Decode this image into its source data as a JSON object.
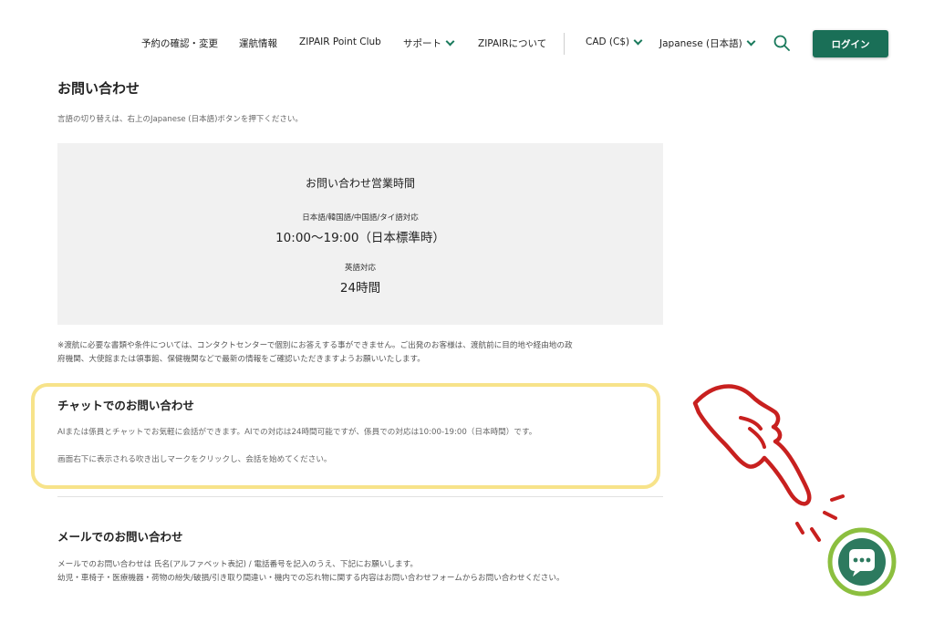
{
  "header": {
    "nav": [
      {
        "label": "予約の確認・変更"
      },
      {
        "label": "運航情報"
      },
      {
        "label": "ZIPAIR Point Club"
      },
      {
        "label": "サポート"
      },
      {
        "label": "ZIPAIRについて"
      }
    ],
    "currency": "CAD (C$)",
    "language": "Japanese (日本語)",
    "login": "ログイン"
  },
  "page": {
    "title": "お問い合わせ",
    "lang_note": "言語の切り替えは、右上のJapanese (日本語)ボタンを押下ください。"
  },
  "hours": {
    "title": "お問い合わせ営業時間",
    "lang1": "日本語/韓国語/中国語/タイ語対応",
    "time1": "10:00〜19:00（日本標準時）",
    "lang2": "英語対応",
    "time2": "24時間"
  },
  "notice": {
    "line1": "※渡航に必要な書類や条件については、コンタクトセンターで個別にお答えする事ができません。ご出発のお客様は、渡航前に目的地や経由地の政",
    "line2": "府機関、大使館または領事館、保健機関などで最新の情報をご確認いただきますようお願いいたします。"
  },
  "chat": {
    "title": "チャットでのお問い合わせ",
    "desc": "AIまたは係員とチャットでお気軽に会話ができます。AIでの対応は24時間可能ですが、係員での対応は10:00-19:00（日本時間）です。",
    "desc2": "画面右下に表示される吹き出しマークをクリックし、会話を始めてください。"
  },
  "mail": {
    "title": "メールでのお問い合わせ",
    "desc1": "メールでのお問い合わせは 氏名(アルファベット表記) / 電話番号を記入のうえ、下記にお願いします。",
    "desc2": "幼児・車椅子・医療機器・荷物の紛失/破損/引き取り間違い・機内での忘れ物に関する内容はお問い合わせフォームからお問い合わせください。"
  },
  "colors": {
    "brand_green": "#1a6f57",
    "highlight_yellow": "#f7e38a",
    "annotation_red": "#c8201f",
    "chat_green": "#8cbf3f"
  }
}
